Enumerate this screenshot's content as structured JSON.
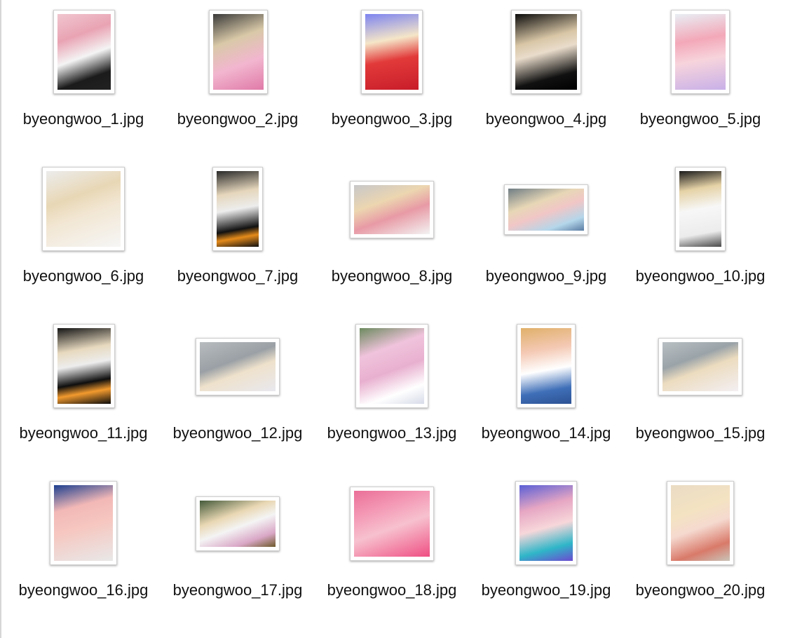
{
  "files": [
    {
      "name": "byeongwoo_1.jpg",
      "bg": "linear-gradient(160deg,#f0c6cf 0%,#e9a3b3 30%,#f4f4f4 55%,#1b1b1b 80%,#222 100%)"
    },
    {
      "name": "byeongwoo_2.jpg",
      "bg": "linear-gradient(160deg,#3a3a3a 0%,#d9c9a8 35%,#f2b6cf 65%,#e07aa8 100%)"
    },
    {
      "name": "byeongwoo_3.jpg",
      "bg": "linear-gradient(170deg,#7d84f0 0%,#f5e6c8 35%,#e23a3a 60%,#c81d2a 100%)"
    },
    {
      "name": "byeongwoo_4.jpg",
      "bg": "linear-gradient(165deg,#0c0c0c 0%,#d8c6a6 35%,#e9dccb 50%,#111 80%,#000 100%)"
    },
    {
      "name": "byeongwoo_5.jpg",
      "bg": "linear-gradient(170deg,#e8eef4 0%,#f3a8b8 35%,#f7d4dc 60%,#c8b0e8 100%)"
    },
    {
      "name": "byeongwoo_6.jpg",
      "bg": "linear-gradient(160deg,#ececec 0%,#e8d7b5 35%,#f2e6d2 55%,#f6f6f6 100%)"
    },
    {
      "name": "byeongwoo_7.jpg",
      "bg": "linear-gradient(170deg,#2a2a2a 0%,#e5d6bc 30%,#ededed 50%,#111 75%,#e58b1a 85%,#111 100%)"
    },
    {
      "name": "byeongwoo_8.jpg",
      "bg": "linear-gradient(160deg,#c7c7c9 0%,#ecd6b0 35%,#e89aa5 60%,#f3f3f3 100%)"
    },
    {
      "name": "byeongwoo_9.jpg",
      "bg": "linear-gradient(160deg,#6f7d84 0%,#e7d7b6 35%,#f1c6c6 55%,#b4d6ea 80%,#5a7ca3 100%)"
    },
    {
      "name": "byeongwoo_10.jpg",
      "bg": "linear-gradient(170deg,#1b1b1b 0%,#e5d2a6 25%,#f7f7f7 50%,#ececec 80%,#4a4a4a 100%)"
    },
    {
      "name": "byeongwoo_11.jpg",
      "bg": "linear-gradient(170deg,#151515 0%,#e7d9bf 30%,#ededed 48%,#0e0e0e 70%,#f29a2e 82%,#0b0b0b 100%)"
    },
    {
      "name": "byeongwoo_12.jpg",
      "bg": "linear-gradient(160deg,#b8bcbf 0%,#9aa0a5 40%,#efe2cc 60%,#e8e8ee 100%)"
    },
    {
      "name": "byeongwoo_13.jpg",
      "bg": "linear-gradient(160deg,#6c8a5f 0%,#f0c3dc 30%,#e8b0cf 55%,#ffffff 80%,#d7dbe8 100%)"
    },
    {
      "name": "byeongwoo_14.jpg",
      "bg": "linear-gradient(170deg,#e0b06a 0%,#f4c9b4 30%,#ffffff 55%,#3f6fb8 80%,#2d5294 100%)"
    },
    {
      "name": "byeongwoo_15.jpg",
      "bg": "linear-gradient(160deg,#b9c0c4 0%,#9aa3a8 35%,#ecdcbf 55%,#f3eff2 100%)"
    },
    {
      "name": "byeongwoo_16.jpg",
      "bg": "linear-gradient(165deg,#1c3f8f 0%,#f2b8b6 30%,#f6c7c0 55%,#e8e8e8 100%)"
    },
    {
      "name": "byeongwoo_17.jpg",
      "bg": "linear-gradient(160deg,#445a3a 0%,#e9d7b3 35%,#f4f4f4 55%,#d9a7c6 80%,#6d5a2a 100%)"
    },
    {
      "name": "byeongwoo_18.jpg",
      "bg": "linear-gradient(160deg,#ea6f98 0%,#f49ab6 30%,#f7c1cf 55%,#ef4f83 100%)"
    },
    {
      "name": "byeongwoo_19.jpg",
      "bg": "linear-gradient(165deg,#5a5fd6 0%,#e6a6c3 30%,#f7d7da 55%,#2fb6c8 80%,#6c4ad0 100%)"
    },
    {
      "name": "byeongwoo_20.jpg",
      "bg": "linear-gradient(160deg,#eadbc4 0%,#f4e3c2 35%,#f5d9cf 55%,#d97a6a 80%,#c9c4b8 100%)"
    }
  ]
}
